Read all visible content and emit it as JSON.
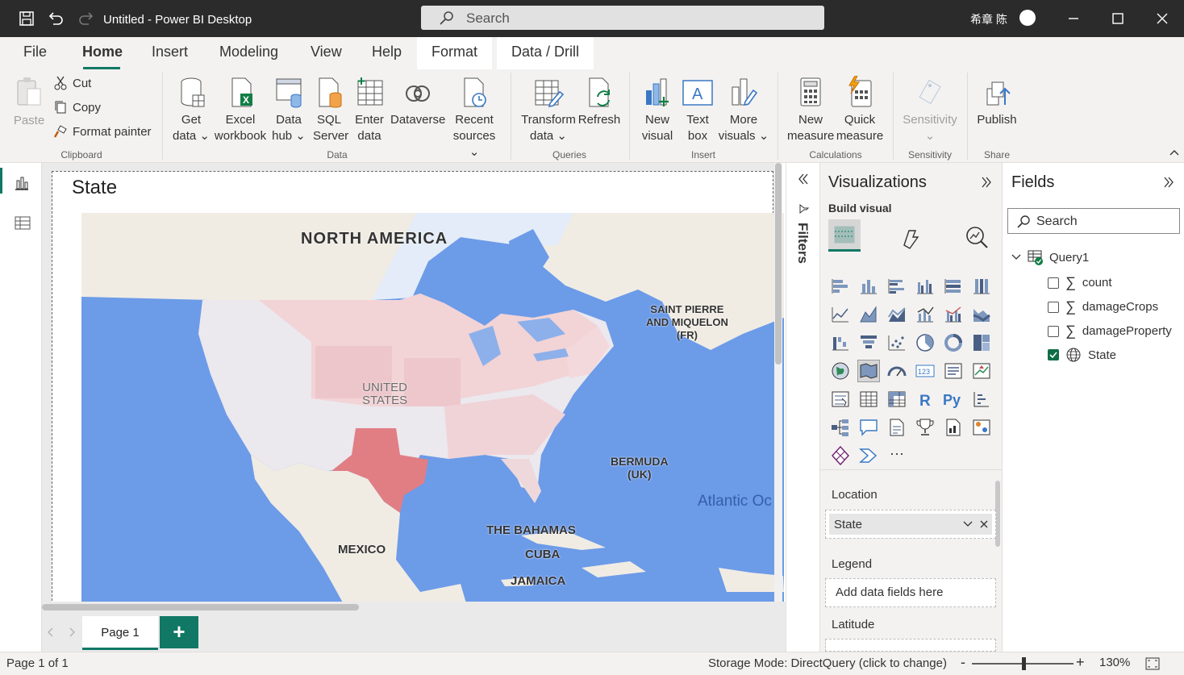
{
  "window": {
    "title": "Untitled - Power BI Desktop",
    "search_placeholder": "Search",
    "user": "希章 陈"
  },
  "tabs": [
    "File",
    "Home",
    "Insert",
    "Modeling",
    "View",
    "Help",
    "Format",
    "Data / Drill"
  ],
  "ribbon": {
    "clipboard": {
      "paste": "Paste",
      "cut": "Cut",
      "copy": "Copy",
      "format_painter": "Format painter",
      "group": "Clipboard"
    },
    "data": {
      "get_data": [
        "Get",
        "data"
      ],
      "excel": [
        "Excel",
        "workbook"
      ],
      "data_hub": [
        "Data",
        "hub"
      ],
      "sql": [
        "SQL",
        "Server"
      ],
      "enter_data": [
        "Enter",
        "data"
      ],
      "dataverse": "Dataverse",
      "recent": [
        "Recent",
        "sources"
      ],
      "group": "Data"
    },
    "queries": {
      "transform": [
        "Transform",
        "data"
      ],
      "refresh": "Refresh",
      "group": "Queries"
    },
    "insert": {
      "new_visual": [
        "New",
        "visual"
      ],
      "text_box": [
        "Text",
        "box"
      ],
      "more_visuals": [
        "More",
        "visuals"
      ],
      "group": "Insert"
    },
    "calculations": {
      "new_measure": [
        "New",
        "measure"
      ],
      "quick_measure": [
        "Quick",
        "measure"
      ],
      "group": "Calculations"
    },
    "sensitivity": {
      "label": "Sensitivity",
      "group": "Sensitivity"
    },
    "share": {
      "publish": "Publish",
      "group": "Share"
    }
  },
  "visual": {
    "title": "State"
  },
  "map_labels": {
    "north_america": "NORTH AMERICA",
    "spm": [
      "SAINT PIERRE",
      "AND MIQUELON",
      "(FR)"
    ],
    "us": [
      "UNITED",
      "STATES"
    ],
    "bermuda": [
      "BERMUDA",
      "(UK)"
    ],
    "atlantic": "Atlantic Oc",
    "mexico": "MEXICO",
    "bahamas": "THE BAHAMAS",
    "cuba": "CUBA",
    "jamaica": "JAMAICA"
  },
  "filters_label": "Filters",
  "visualizations": {
    "title": "Visualizations",
    "build_visual": "Build visual",
    "location_label": "Location",
    "location_value": "State",
    "legend_label": "Legend",
    "legend_placeholder": "Add data fields here",
    "latitude_label": "Latitude",
    "more": "···"
  },
  "fields": {
    "title": "Fields",
    "search_placeholder": "Search",
    "table": "Query1",
    "items": [
      {
        "name": "count",
        "checked": false,
        "icon": "sigma-icon"
      },
      {
        "name": "damageCrops",
        "checked": false,
        "icon": "sigma-icon"
      },
      {
        "name": "damageProperty",
        "checked": false,
        "icon": "sigma-icon"
      },
      {
        "name": "State",
        "checked": true,
        "icon": "globe-icon"
      }
    ]
  },
  "pages": {
    "current": "Page 1",
    "add": "+"
  },
  "status": {
    "page": "Page 1 of 1",
    "storage": "Storage Mode: DirectQuery (click to change)",
    "zoom": "130%"
  },
  "colors": {
    "accent": "#117865",
    "brand_titlebar": "#2b2b2b",
    "highlight_state": "#e07e84",
    "ocean": "#6c9be8"
  }
}
